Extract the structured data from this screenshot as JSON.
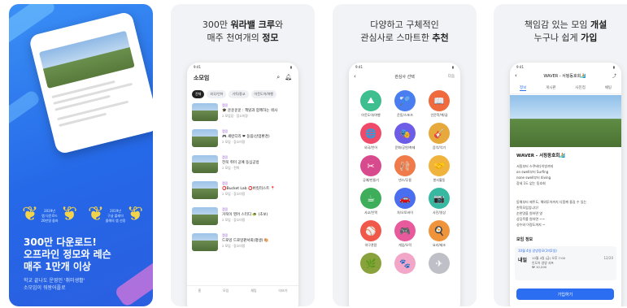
{
  "card1": {
    "award_left": "2019년\n앱 다운로드\n20만명 돌파",
    "award_right": "2019년\n구글 플레이\n올해의 앱 선정",
    "headline": "300만 다운로드!\n오프라인 정모와 레슨\n매주 1만개 이상",
    "subtext": "학교 끝나도 운영인 '취미생활'\n소모임이 워왕어플로"
  },
  "card2": {
    "headline_pre": "300만 ",
    "headline_bold": "워라밸 크루",
    "headline_post": "와",
    "headline2_pre": "매주 천여개의 ",
    "headline2_bold": "정모",
    "time": "9:41",
    "app_title": "소모임",
    "chips": [
      "전체",
      "외국/언어",
      "기독/종교",
      "아웃도어/여행"
    ],
    "rows": [
      {
        "tag": "캠핑",
        "title": "🎓 운운운운 : 책읽과 함께하는 색사",
        "meta": "2 모임장 · 장소미정"
      },
      {
        "tag": "캠핑",
        "title": "🎮 세련디리 ❤ 동림(산업환경)",
        "meta": "2 모임 · 장소미정"
      },
      {
        "tag": "캠핑",
        "title": "전북 취미 공예 동심공방",
        "meta": "2 모임 · 전북"
      },
      {
        "tag": "캠핑",
        "title": "⭕Bucket Lab ⭕버킷리스트 📍",
        "meta": "2 모임 · 장소미정"
      },
      {
        "tag": "캠핑",
        "title": "거북이 영어 스터디 🐢 (초보)",
        "meta": "2 모임 · 장소미정"
      },
      {
        "tag": "캠핑",
        "title": "드로잉 드로잉판서회(평생) 🎨",
        "meta": "2 모임 · 장소미정"
      }
    ],
    "tabs": [
      "홈",
      "모임",
      "채팅",
      "더보기"
    ]
  },
  "card3": {
    "headline1": "다양하고 구체적인",
    "headline2_pre": "관심사로 스마트한 ",
    "headline2_bold": "추천",
    "time": "9:41",
    "screen_title": "관심사 선택",
    "next": "다음",
    "interests": [
      {
        "label": "아웃도어/여행",
        "color": "#3fbf8f",
        "icon": "⛰"
      },
      {
        "label": "운동/스포츠",
        "color": "#4a7ef0",
        "icon": "🏸"
      },
      {
        "label": "인문학/책/글",
        "color": "#ef6a3c",
        "icon": "📖"
      },
      {
        "label": "외국/언어",
        "color": "#f04a6a",
        "icon": "🌐"
      },
      {
        "label": "문화/공연/축제",
        "color": "#6c5ce7",
        "icon": "🎭"
      },
      {
        "label": "음악/악기",
        "color": "#e8a93c",
        "icon": "🎸"
      },
      {
        "label": "공예/만들기",
        "color": "#d84a8e",
        "icon": "✂"
      },
      {
        "label": "댄스/무용",
        "color": "#f07a4a",
        "icon": "🩰"
      },
      {
        "label": "봉사활동",
        "color": "#f0b43c",
        "icon": "🤝"
      },
      {
        "label": "사교/인맥",
        "color": "#3fae5a",
        "icon": "☕"
      },
      {
        "label": "차/오토바이",
        "color": "#4a6ef0",
        "icon": "🚗"
      },
      {
        "label": "사진/영상",
        "color": "#37b8a0",
        "icon": "📷"
      },
      {
        "label": "야구관람",
        "color": "#f0584a",
        "icon": "⚾"
      },
      {
        "label": "게임/오락",
        "color": "#e85a9c",
        "icon": "🎮"
      },
      {
        "label": "요리/제조",
        "color": "#f0943c",
        "icon": "🍳"
      },
      {
        "label": "",
        "color": "#8aa23c",
        "icon": "🌿"
      },
      {
        "label": "",
        "color": "#f2a6c8",
        "icon": "🐾"
      },
      {
        "label": "",
        "color": "#bfbfc8",
        "icon": "✈"
      }
    ]
  },
  "card4": {
    "headline1": "책임감 있는 모임 ",
    "headline1_bold": "개설",
    "headline2_pre": "누구나 쉽게 ",
    "headline2_bold": "가입",
    "time": "9:41",
    "club_title": "WAVER - 서핑동호회🏄",
    "tabs": [
      "정보",
      "게시판",
      "사진첩",
      "채팅"
    ],
    "name": "WAVER - 서핑동호회🏄",
    "desc": "서핑부터 스쿠버다이빙까지\non swell부터 Surfing\nnone swell부터 diving\n장세 1도 없는 동호회",
    "desc2": "동해부터 제주도, 해외투어까지 다함께 즐길 수 있는\n친목모임입니다!\n순한맛을 원하면 영\n상딩주를 원하면 ~~\n성수와 이정도까지 ~",
    "section": "모임 정모",
    "event_tag": "10월 4일 양양정모(1박2일)",
    "event_day": "내일",
    "event_date": "10월 4일 (금) 오후 7:00",
    "event_place": "인도어 양양 서프",
    "event_price": "₩ 10,000",
    "event_count": "12/20",
    "join": "가입하기"
  }
}
